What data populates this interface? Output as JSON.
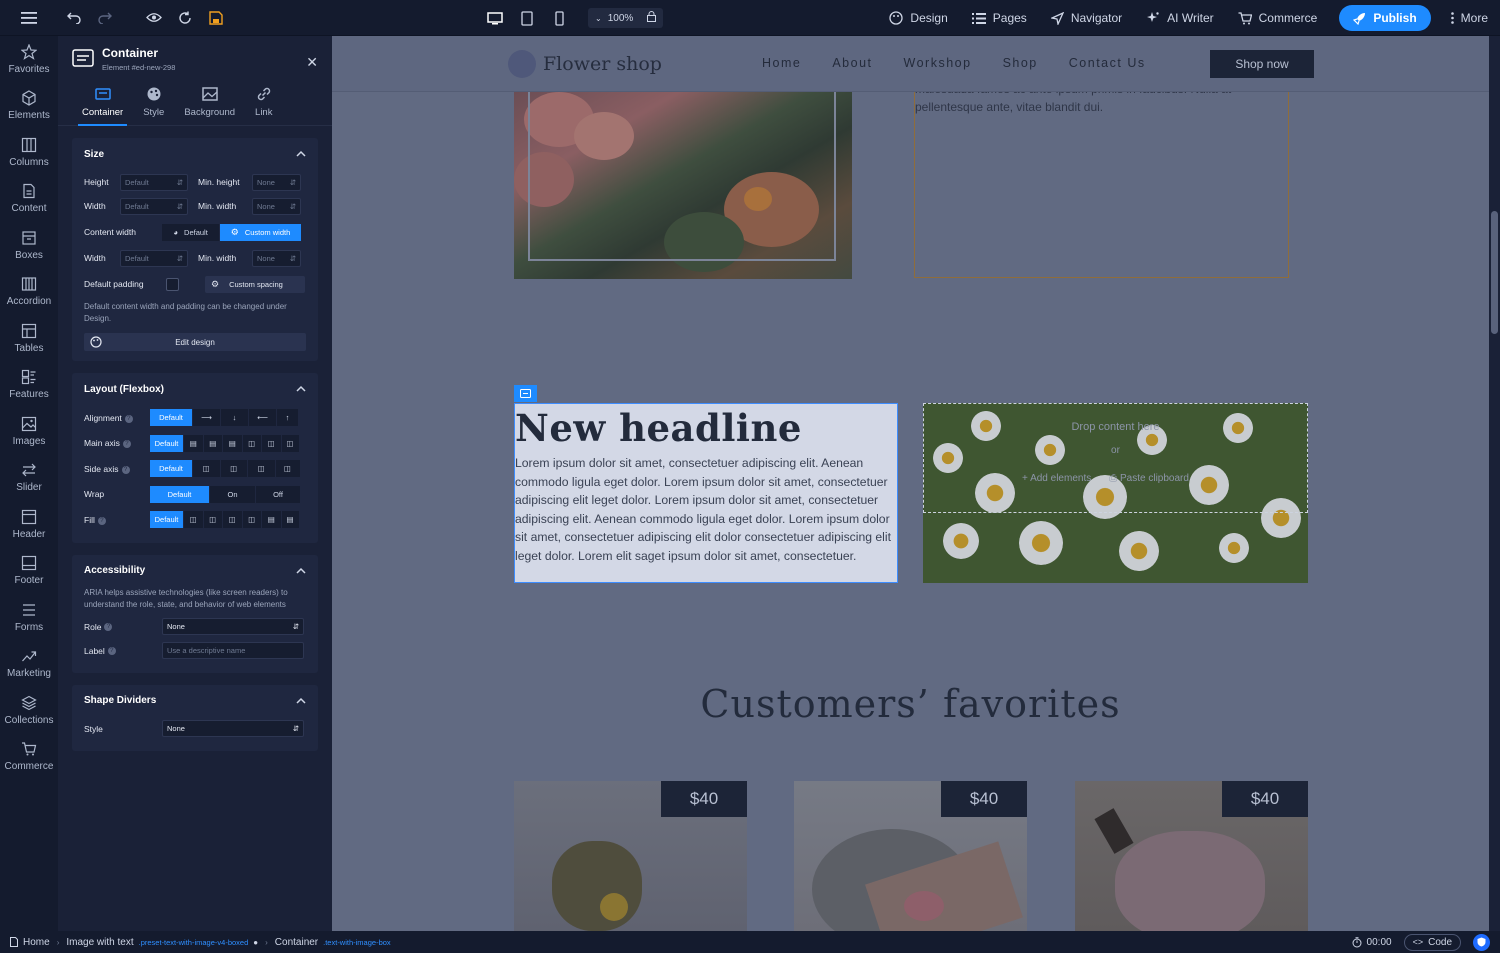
{
  "toolbar": {
    "zoom": "100%",
    "items": [
      "Design",
      "Pages",
      "Navigator",
      "AI Writer",
      "Commerce"
    ],
    "publish": "Publish",
    "more": "More"
  },
  "rail": {
    "items": [
      "Favorites",
      "Elements",
      "Columns",
      "Content",
      "Boxes",
      "Accordion",
      "Tables",
      "Features",
      "Images",
      "Slider",
      "Header",
      "Footer",
      "Forms",
      "Marketing",
      "Collections",
      "Commerce"
    ]
  },
  "panel": {
    "title": "Container",
    "subtitle": "Element #ed-new-298",
    "tabs": [
      "Container",
      "Style",
      "Background",
      "Link"
    ],
    "size": {
      "title": "Size",
      "height_label": "Height",
      "min_height_label": "Min. height",
      "width_label": "Width",
      "min_width_label": "Min. width",
      "field_default": "Default",
      "field_none": "None",
      "content_width_label": "Content width",
      "content_width_default": "Default",
      "content_width_custom": "Custom width",
      "default_padding_label": "Default padding",
      "custom_spacing": "Custom spacing",
      "note": "Default content width and padding can be changed under Design.",
      "edit_design": "Edit design"
    },
    "layout": {
      "title": "Layout (Flexbox)",
      "alignment": "Alignment",
      "main_axis": "Main axis",
      "side_axis": "Side axis",
      "wrap": "Wrap",
      "fill": "Fill",
      "default": "Default",
      "on": "On",
      "off": "Off"
    },
    "accessibility": {
      "title": "Accessibility",
      "note": "ARIA helps assistive technologies (like screen readers) to understand the role, state, and behavior of web elements",
      "role_label": "Role",
      "role_value": "None",
      "label_label": "Label",
      "label_placeholder": "Use a descriptive name"
    },
    "dividers": {
      "title": "Shape Dividers",
      "style_label": "Style",
      "style_value": "None"
    }
  },
  "site": {
    "logo": "Flower shop",
    "nav": [
      "Home",
      "About",
      "Workshop",
      "Shop",
      "Contact Us"
    ],
    "cta": "Shop now",
    "partial_text": "malesuada fames ac ante ipsum primis in faucibus. Nulla at pellentesque ante, vitae blandit dui.",
    "headline": "New headline",
    "body": "Lorem ipsum dolor sit amet, consectetuer adipiscing elit. Aenean commodo ligula eget dolor. Lorem ipsum dolor sit amet, consectetuer adipiscing elit leget dolor. Lorem ipsum dolor sit amet, consectetuer adipiscing elit. Aenean commodo ligula eget dolor. Lorem ipsum dolor sit amet, consectetuer adipiscing elit dolor consectetuer adipiscing elit leget dolor. Lorem elit saget ipsum dolor sit amet, consectetuer.",
    "drop_text": "Drop content here",
    "drop_or": "or",
    "add_elements": "Add elements",
    "paste_clipboard": "Paste clipboard",
    "favorites_title": "Customers’ favorites",
    "prices": [
      "$40",
      "$40",
      "$40"
    ]
  },
  "bottombar": {
    "crumbs": [
      {
        "label": "Home",
        "cls": ""
      },
      {
        "label": "Image with text",
        "cls": ".preset-text-with-image-v4-boxed"
      },
      {
        "label": "Container",
        "cls": ".text-with-image-box"
      }
    ],
    "time": "00:00",
    "code": "Code"
  },
  "colors": {
    "accent": "#1e8bff",
    "panel_bg": "#1a2137",
    "topbar_bg": "#141b2e",
    "canvas_overlay": "#616a82"
  }
}
